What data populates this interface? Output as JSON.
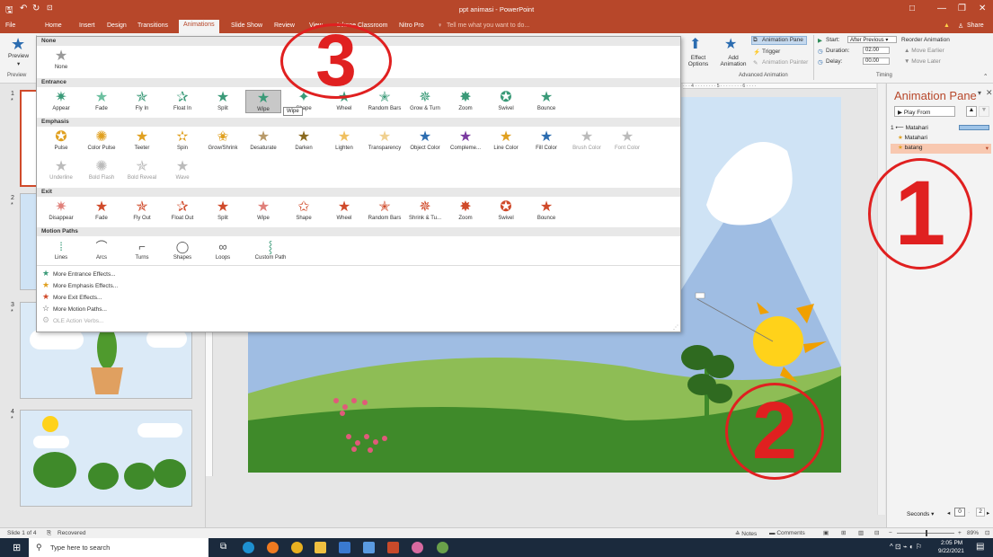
{
  "window": {
    "title": "ppt animasi - PowerPoint",
    "controls": [
      "□",
      "—",
      "❐",
      "✕"
    ]
  },
  "tabs": [
    "File",
    "Home",
    "Insert",
    "Design",
    "Transitions",
    "Animations",
    "Slide Show",
    "Review",
    "View",
    "Inknoe Classroom",
    "Nitro Pro",
    "Tell me what you want to do..."
  ],
  "share": "Share",
  "ribbon": {
    "preview": "Preview",
    "preview_group": "Preview",
    "effect_options": "Effect Options",
    "add_animation": "Add Animation",
    "animation_pane": "Animation Pane",
    "trigger": "Trigger",
    "animation_painter": "Animation Painter",
    "advanced_group": "Advanced Animation",
    "start_label": "Start:",
    "start_value": "After Previous",
    "duration_label": "Duration:",
    "duration_value": "02.00",
    "delay_label": "Delay:",
    "delay_value": "00.00",
    "reorder": "Reorder Animation",
    "move_earlier": "Move Earlier",
    "move_later": "Move Later",
    "timing_group": "Timing"
  },
  "gallery": {
    "none_header": "None",
    "none_label": "None",
    "entrance_header": "Entrance",
    "entrance": [
      "Appear",
      "Fade",
      "Fly In",
      "Float In",
      "Split",
      "Wipe",
      "Shape",
      "Wheel",
      "Random Bars",
      "Grow & Turn",
      "Zoom",
      "Swivel",
      "Bounce"
    ],
    "tooltip": "Wipe",
    "emphasis_header": "Emphasis",
    "emphasis": [
      "Pulse",
      "Color Pulse",
      "Teeter",
      "Spin",
      "Grow/Shrink",
      "Desaturate",
      "Darken",
      "Lighten",
      "Transparency",
      "Object Color",
      "Compleme...",
      "Line Color",
      "Fill Color",
      "Brush Color",
      "Font Color",
      "Underline",
      "Bold Flash",
      "Bold Reveal",
      "Wave"
    ],
    "exit_header": "Exit",
    "exit": [
      "Disappear",
      "Fade",
      "Fly Out",
      "Float Out",
      "Split",
      "Wipe",
      "Shape",
      "Wheel",
      "Random Bars",
      "Shrink & Tu...",
      "Zoom",
      "Swivel",
      "Bounce"
    ],
    "motion_header": "Motion Paths",
    "motion": [
      "Lines",
      "Arcs",
      "Turns",
      "Shapes",
      "Loops",
      "Custom Path"
    ],
    "more": [
      "More Entrance Effects...",
      "More Emphasis Effects...",
      "More Exit Effects...",
      "More Motion Paths...",
      "OLE Action Verbs..."
    ]
  },
  "slides": [
    "1",
    "2",
    "3",
    "4"
  ],
  "animation_pane": {
    "title": "Animation Pane",
    "play_from": "Play From",
    "items": [
      {
        "num": "1",
        "name": "Matahari"
      },
      {
        "num": "",
        "name": "Matahari"
      },
      {
        "num": "",
        "name": "batang"
      }
    ],
    "seconds": "Seconds",
    "page_start": "0",
    "page_end": "2"
  },
  "status": {
    "slide": "Slide 1 of 4",
    "recovered": "Recovered",
    "notes": "Notes",
    "comments": "Comments",
    "zoom": "89%"
  },
  "taskbar": {
    "search": "Type here to search",
    "time": "2:05 PM",
    "date": "9/22/2021"
  },
  "annotations": [
    "1",
    "2",
    "3"
  ],
  "colors": {
    "accent": "#b7472a",
    "entrance": "#3a9a78",
    "emphasis": "#e0a020",
    "exit": "#d04a2a",
    "annotation": "#e02020"
  }
}
